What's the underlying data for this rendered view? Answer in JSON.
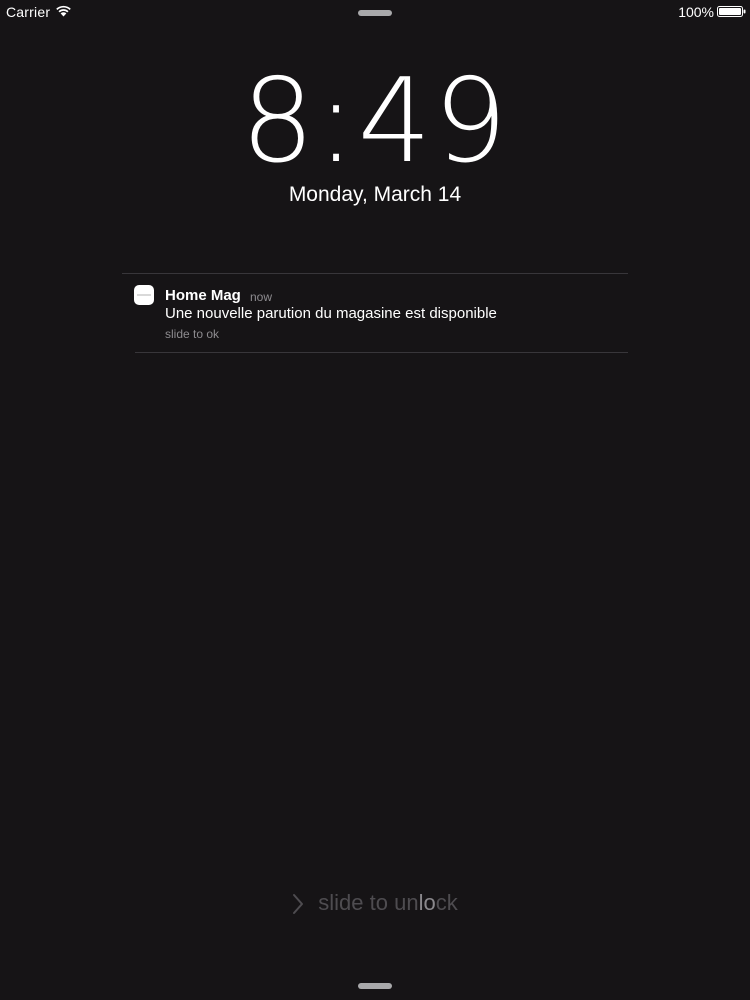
{
  "status_bar": {
    "carrier": "Carrier",
    "wifi_icon": "wifi-icon",
    "battery_percent": "100%",
    "battery_icon": "battery-icon",
    "battery_level": 1.0
  },
  "clock": {
    "hour": "8",
    "separator": ":",
    "minutes": "49",
    "date": "Monday, March 14"
  },
  "notification": {
    "app_name": "Home Mag",
    "time": "now",
    "message": "Une nouvelle parution du magasine est disponible",
    "action_hint": "slide to ok",
    "app_icon": "home-mag-app-icon"
  },
  "unlock": {
    "text_part1": "slide to un",
    "text_highlight": "lo",
    "text_part2": "ck",
    "chevron_icon": "chevron-right-icon"
  },
  "colors": {
    "background": "#161416",
    "text_primary": "#ffffff",
    "text_secondary": "#8d8b8f",
    "divider": "#38363a",
    "unlock_dim": "#4e4c50",
    "unlock_shine": "#8a888c"
  }
}
